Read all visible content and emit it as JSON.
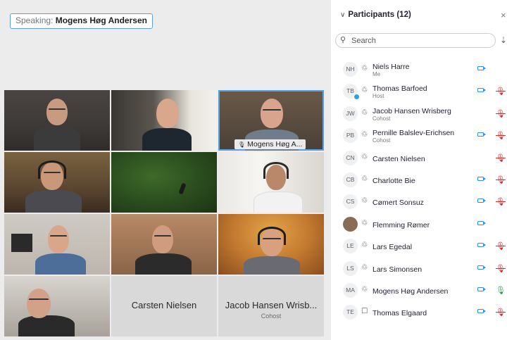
{
  "speaking": {
    "label": "Speaking:",
    "name": "Mogens Høg Andersen"
  },
  "grid": {
    "selected_tag": "Mogens Høg A...",
    "carsten": {
      "name": "Carsten Nielsen"
    },
    "jacob": {
      "name": "Jacob Hansen Wrisb...",
      "role": "Cohost"
    }
  },
  "panel": {
    "title": "Participants (12)",
    "chevron_icon": "chevron-down-icon",
    "close_icon": "close-icon",
    "search_placeholder": "Search",
    "sort_icon": "sort-icon",
    "participants": [
      {
        "initials": "NH",
        "name": "Niels Harre",
        "role": "Me",
        "video": true,
        "mic": "none"
      },
      {
        "initials": "TB",
        "name": "Thomas Barfoed",
        "role": "Host",
        "video": true,
        "mic": "muted"
      },
      {
        "initials": "JW",
        "name": "Jacob Hansen Wrisberg",
        "role": "Cohost",
        "video": false,
        "mic": "muted"
      },
      {
        "initials": "PB",
        "name": "Pernille Balslev-Erichsen",
        "role": "Cohost",
        "video": true,
        "mic": "muted"
      },
      {
        "initials": "CN",
        "name": "Carsten Nielsen",
        "role": "",
        "video": false,
        "mic": "muted"
      },
      {
        "initials": "CB",
        "name": "Charlotte Bie",
        "role": "",
        "video": true,
        "mic": "muted"
      },
      {
        "initials": "CS",
        "name": "Cømert Sonsuz",
        "role": "",
        "video": true,
        "mic": "muted"
      },
      {
        "initials": "",
        "name": "Flemming Rømer",
        "role": "",
        "video": true,
        "mic": "none"
      },
      {
        "initials": "LE",
        "name": "Lars Egedal",
        "role": "",
        "video": true,
        "mic": "muted"
      },
      {
        "initials": "LS",
        "name": "Lars Simonsen",
        "role": "",
        "video": true,
        "mic": "muted"
      },
      {
        "initials": "MA",
        "name": "Mogens Høg Andersen",
        "role": "",
        "video": true,
        "mic": "on"
      },
      {
        "initials": "TE",
        "name": "Thomas Elgaard",
        "role": "",
        "video": true,
        "mic": "muted"
      }
    ]
  },
  "colors": {
    "accent": "#2d8cff",
    "muted": "#e02828",
    "unmuted": "#1aa04a",
    "speaker_border": "#5aa1e3"
  }
}
